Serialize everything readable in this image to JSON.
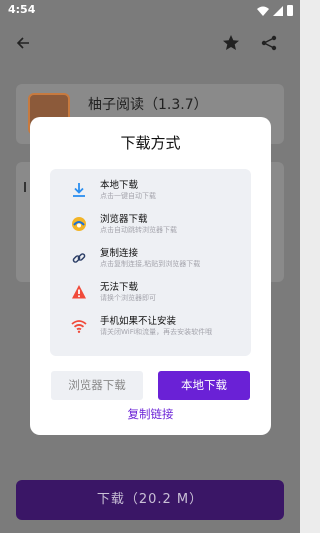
{
  "status_bar": {
    "time": "4:54"
  },
  "app_bar": {
    "back_icon": "arrow-back-icon",
    "star_icon": "star-icon",
    "share_icon": "share-icon"
  },
  "app": {
    "title": "柚子阅读（1.3.7）"
  },
  "download_bar": {
    "label": "下载（20.2 M）"
  },
  "dialog": {
    "title": "下载方式",
    "options": [
      {
        "name": "本地下载",
        "desc": "点击一键自动下载",
        "icon": "download-icon"
      },
      {
        "name": "浏览器下载",
        "desc": "点击自动跳转浏览器下载",
        "icon": "browser-icon"
      },
      {
        "name": "复制连接",
        "desc": "点击复制连接,粘贴到浏览器下载",
        "icon": "link-icon"
      },
      {
        "name": "无法下载",
        "desc": "请换个浏览器即可",
        "icon": "warning-icon"
      },
      {
        "name": "手机如果不让安装",
        "desc": "请关闭WiFi和流量，再去安装软件哦",
        "icon": "wifi-icon"
      }
    ],
    "browser_button": "浏览器下载",
    "local_button": "本地下载",
    "copy_link": "复制链接"
  },
  "colors": {
    "accent": "#6a21d6",
    "overlay": "#7b7b7b",
    "panel": "#eef0f4"
  }
}
